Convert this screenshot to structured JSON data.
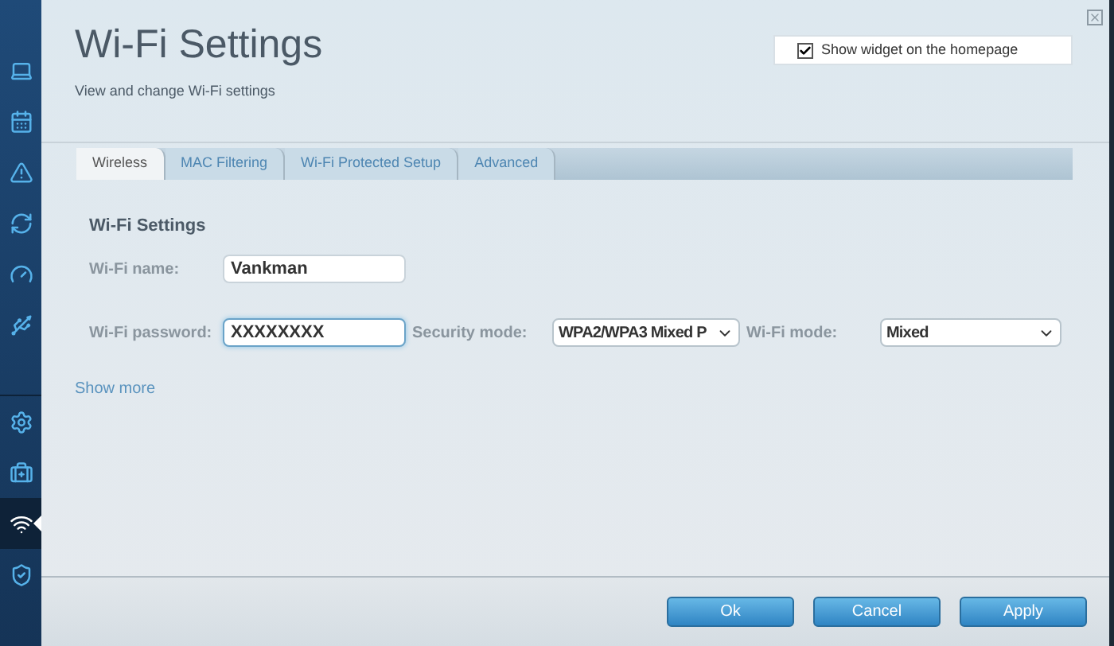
{
  "sidebar": {
    "groups": [
      {
        "items": [
          {
            "selected": false
          },
          {
            "selected": false
          },
          {
            "selected": false
          },
          {
            "selected": false
          },
          {
            "selected": false
          },
          {
            "selected": false
          }
        ]
      },
      {
        "items": [
          {
            "selected": false
          },
          {
            "selected": false
          },
          {
            "selected": true
          },
          {
            "selected": false
          }
        ]
      }
    ]
  },
  "header": {
    "title": "Wi-Fi Settings",
    "subtitle": "View and change Wi-Fi settings",
    "widget_option": {
      "label": "Show widget on the homepage",
      "checked": true
    }
  },
  "tabs": [
    {
      "label": "Wireless",
      "selected": true
    },
    {
      "label": "MAC Filtering",
      "selected": false
    },
    {
      "label": "Wi-Fi Protected Setup",
      "selected": false
    },
    {
      "label": "Advanced",
      "selected": false
    }
  ],
  "section": {
    "title": "Wi-Fi Settings",
    "wifi_name": {
      "label": "Wi-Fi name:",
      "value": "Vankman"
    },
    "wifi_password": {
      "label": "Wi-Fi password:",
      "value": "XXXXXXXX"
    },
    "security_mode": {
      "label": "Security mode:",
      "value": "WPA2/WPA3 Mixed P"
    },
    "wifi_mode": {
      "label": "Wi-Fi mode:",
      "value": "Mixed"
    },
    "show_more": "Show more"
  },
  "buttons": [
    "Ok",
    "Cancel",
    "Apply"
  ]
}
